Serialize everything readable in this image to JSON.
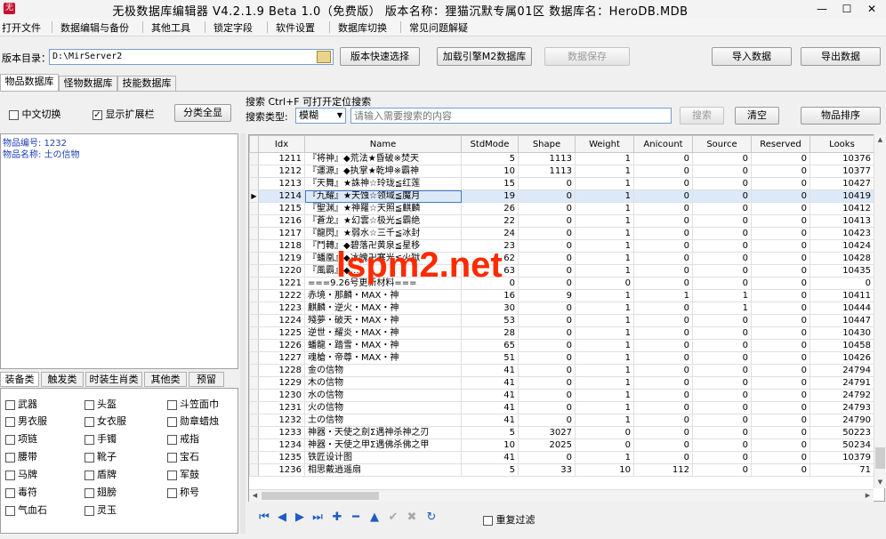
{
  "window": {
    "title": "无极数据库编辑器 V4.2.1.9    Beta 1.0（免费版）    版本名称：狸猫沉默专属01区    数据库名：HeroDB.MDB",
    "app_icon": "无",
    "min": "—",
    "max": "☐",
    "close": "✕"
  },
  "menu": [
    "打开文件",
    "数据编辑与备份",
    "其他工具",
    "锁定字段",
    "软件设置",
    "数据库切换",
    "常见问题解疑"
  ],
  "toolbar": {
    "dir_label": "版本目录：",
    "dir_value": "D:\\MirServer2",
    "version_button": "版本快速选择",
    "load_button": "加载引擎M2数据库",
    "save_button": "数据保存",
    "import_button": "导入数据",
    "export_button": "导出数据"
  },
  "tabs": [
    "物品数据库",
    "怪物数据库",
    "技能数据库"
  ],
  "filters": {
    "chinese_toggle": "中文切换",
    "show_ext": "显示扩展栏",
    "classify_button": "分类全显",
    "search_title": "搜索   Ctrl+F 可打开定位搜索",
    "search_type_label": "搜索类型:",
    "search_type_value": "模糊",
    "search_placeholder": "请输入需要搜索的内容",
    "search_button": "搜索",
    "clear_button": "清空",
    "sort_button": "物品排序"
  },
  "item_info": {
    "id_line": "物品编号: 1232",
    "name_line": "物品名称: 土の信物"
  },
  "bottom_tabs": [
    "装备类",
    "触发类",
    "时装生肖类",
    "其他类",
    "预留"
  ],
  "categories": [
    [
      "武器",
      "头盔",
      "斗笠面巾"
    ],
    [
      "男衣服",
      "女衣服",
      "勋章蜡烛"
    ],
    [
      "项链",
      "手镯",
      "戒指"
    ],
    [
      "腰带",
      "靴子",
      "宝石"
    ],
    [
      "马牌",
      "盾牌",
      "军鼓"
    ],
    [
      "毒符",
      "翅膀",
      "称号"
    ],
    [
      "气血石",
      "灵玉"
    ]
  ],
  "table": {
    "columns": [
      "Idx",
      "Name",
      "StdMode",
      "Shape",
      "Weight",
      "Anicount",
      "Source",
      "Reserved",
      "Looks"
    ],
    "selected_idx": "1214",
    "rows": [
      [
        "1211",
        "『将神』◆荒法★昏破※焚天",
        "5",
        "1113",
        "1",
        "0",
        "0",
        "0",
        "10376"
      ],
      [
        "1212",
        "『運源』◆执掌★乾坤※霸神",
        "10",
        "1113",
        "1",
        "0",
        "0",
        "0",
        "10377"
      ],
      [
        "1213",
        "『天舞』★誅神☆玲珑≦红莲",
        "15",
        "0",
        "1",
        "0",
        "0",
        "0",
        "10427"
      ],
      [
        "1214",
        "『九耀』★天蚀☆领域≦魔月",
        "19",
        "0",
        "1",
        "0",
        "0",
        "0",
        "10419"
      ],
      [
        "1215",
        "『聖渊』★神羅☆天照≦麒麟",
        "26",
        "0",
        "1",
        "0",
        "0",
        "0",
        "10412"
      ],
      [
        "1216",
        "『蒼龙』★幻雲☆极光≦霸绝",
        "22",
        "0",
        "1",
        "0",
        "0",
        "0",
        "10413"
      ],
      [
        "1217",
        "『龍閃』★弱水☆三千≦冰封",
        "24",
        "0",
        "1",
        "0",
        "0",
        "0",
        "10423"
      ],
      [
        "1218",
        "『鬥轉』◆碧落卍黄泉≦星移",
        "23",
        "0",
        "1",
        "0",
        "0",
        "0",
        "10424"
      ],
      [
        "1219",
        "『蟠凰』◆冰魄卍寒光≦火獄",
        "62",
        "0",
        "1",
        "0",
        "0",
        "0",
        "10428"
      ],
      [
        "1220",
        "『風霸』◆…",
        "63",
        "0",
        "1",
        "0",
        "0",
        "0",
        "10435"
      ],
      [
        "1221",
        "===9.26号更新材料===",
        "0",
        "0",
        "0",
        "0",
        "0",
        "0",
        "0"
      ],
      [
        "1222",
        "赤境・那麟・MAX・神",
        "16",
        "9",
        "1",
        "1",
        "1",
        "0",
        "10411"
      ],
      [
        "1223",
        "麒麟・逆火・MAX・神",
        "30",
        "0",
        "1",
        "0",
        "1",
        "0",
        "10444"
      ],
      [
        "1224",
        "殘夢・破天・MAX・神",
        "53",
        "0",
        "1",
        "0",
        "0",
        "0",
        "10447"
      ],
      [
        "1225",
        "逆世・耀炎・MAX・神",
        "28",
        "0",
        "1",
        "0",
        "0",
        "0",
        "10430"
      ],
      [
        "1226",
        "蟠龍・踏雪・MAX・神",
        "65",
        "0",
        "1",
        "0",
        "0",
        "0",
        "10458"
      ],
      [
        "1227",
        "魂槍・帝尊・MAX・神",
        "51",
        "0",
        "1",
        "0",
        "0",
        "0",
        "10426"
      ],
      [
        "1228",
        "金の信物",
        "41",
        "0",
        "1",
        "0",
        "0",
        "0",
        "24794"
      ],
      [
        "1229",
        "木の信物",
        "41",
        "0",
        "1",
        "0",
        "0",
        "0",
        "24791"
      ],
      [
        "1230",
        "水の信物",
        "41",
        "0",
        "1",
        "0",
        "0",
        "0",
        "24792"
      ],
      [
        "1231",
        "火の信物",
        "41",
        "0",
        "1",
        "0",
        "0",
        "0",
        "24793"
      ],
      [
        "1232",
        "土の信物",
        "41",
        "0",
        "1",
        "0",
        "0",
        "0",
        "24790"
      ],
      [
        "1233",
        "神器・天使之劍Σ遇神杀神之刃",
        "5",
        "3027",
        "0",
        "0",
        "0",
        "0",
        "50223"
      ],
      [
        "1234",
        "神器・天使之甲Σ遇佛杀佛之甲",
        "10",
        "2025",
        "0",
        "0",
        "0",
        "0",
        "50234"
      ],
      [
        "1235",
        "铁匠设计图",
        "41",
        "0",
        "1",
        "0",
        "0",
        "0",
        "10379"
      ],
      [
        "1236",
        "相思戴逍遥扇",
        "5",
        "33",
        "10",
        "112",
        "0",
        "0",
        "71"
      ]
    ]
  },
  "nav": {
    "icons": [
      "first-icon",
      "prev-icon",
      "next-icon",
      "last-icon",
      "add-icon",
      "delete-icon",
      "up-icon",
      "confirm-icon",
      "cancel-icon",
      "refresh-icon"
    ],
    "glyphs": [
      "⏮",
      "◀",
      "▶",
      "⏭",
      "✚",
      "━",
      "▲",
      "✔",
      "✖",
      "↻"
    ],
    "dedupe_label": "重复过滤"
  },
  "watermark": "lspm2.net",
  "colors": {
    "accent": "#1e5bc6",
    "watermark": "#ff2a00",
    "info_text": "#1d3fb6",
    "selected_row": "#dce9f8"
  }
}
